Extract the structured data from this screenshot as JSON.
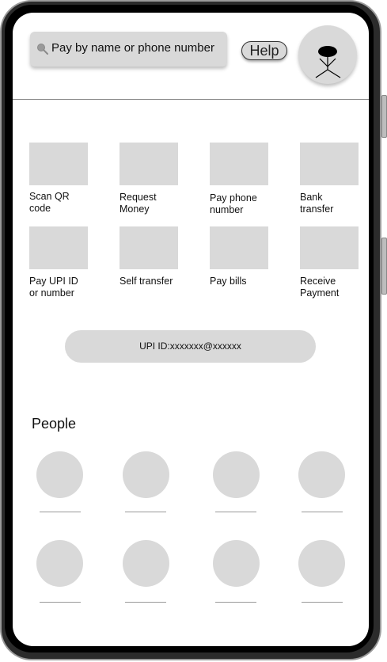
{
  "header": {
    "search_placeholder": "Pay by name or phone number",
    "help_label": "Help"
  },
  "actions": [
    {
      "label": "Scan QR code",
      "icon": "qr-scan-icon"
    },
    {
      "label": "Request Money",
      "icon": "request-money-icon"
    },
    {
      "label": "Pay phone number",
      "icon": "phone-icon"
    },
    {
      "label": "Bank transfer",
      "icon": "bank-icon"
    },
    {
      "label": "Pay UPI ID or number",
      "icon": "upi-icon"
    },
    {
      "label": "Self transfer",
      "icon": "self-transfer-icon"
    },
    {
      "label": "Pay bills",
      "icon": "bill-icon"
    },
    {
      "label": "Receive Payment",
      "icon": "receive-icon"
    }
  ],
  "upi": {
    "label": "UPI ID:xxxxxxx@xxxxxx"
  },
  "people": {
    "title": "People",
    "count_visible": 8
  },
  "colors": {
    "placeholder_gray": "#d9d9d9",
    "frame": "#2b2b2b"
  }
}
